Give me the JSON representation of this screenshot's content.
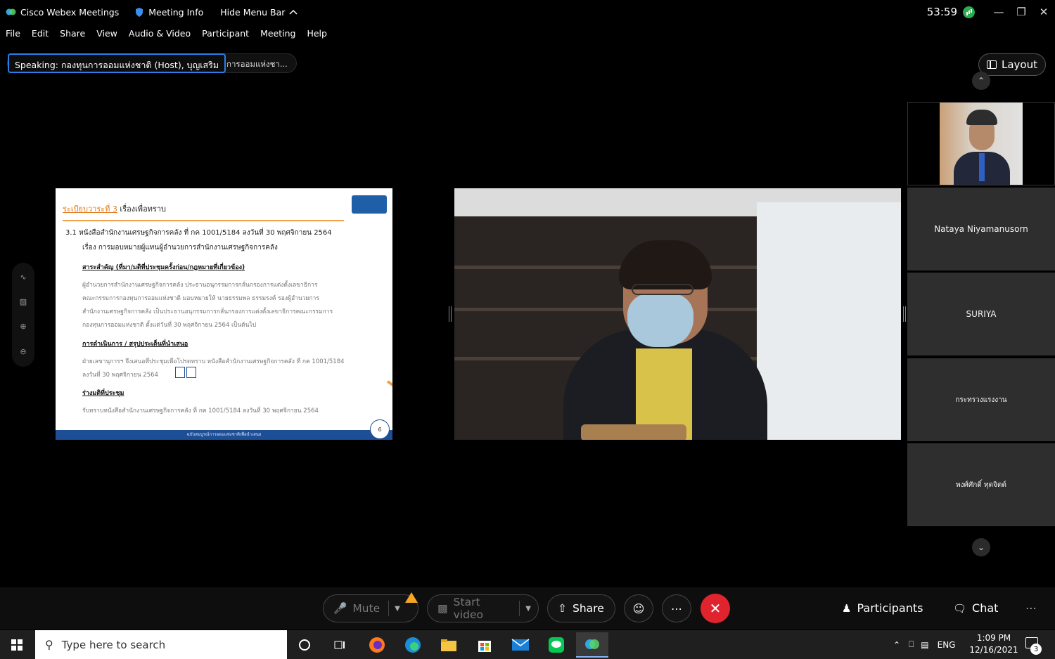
{
  "titlebar": {
    "app_name": "Cisco Webex Meetings",
    "meeting_info": "Meeting Info",
    "hide_menu": "Hide Menu Bar",
    "timer": "53:59"
  },
  "menu": [
    "File",
    "Edit",
    "Share",
    "View",
    "Audio & Video",
    "Participant",
    "Meeting",
    "Help"
  ],
  "speaking": {
    "text": "Speaking: กองทุนการออมแห่งชาติ (Host), บุญเสริม",
    "overflow": "การออมแห่งชา..."
  },
  "layout_label": "Layout",
  "slide": {
    "agenda": "ระเบียบวาระที่ 3",
    "agenda_title": "เรื่องเพื่อทราบ",
    "item_line1": "3.1  หนังสือสำนักงานเศรษฐกิจการคลัง ที่ กค 1001/5184 ลงวันที่ 30 พฤศจิกายน 2564",
    "item_line2": "เรื่อง การมอบหมายผู้แทนผู้อำนวยการสำนักงานเศรษฐกิจการคลัง",
    "section1": "สาระสำคัญ (ที่มา/มติที่ประชุมครั้งก่อน/กฎหมายที่เกี่ยวข้อง)",
    "body1": [
      "ผู้อำนวยการสำนักงานเศรษฐกิจการคลัง ประธานอนุกรรมการกลั่นกรองการแต่งตั้งเลขาธิการ",
      "คณะกรรมการกองทุนการออมแห่งชาติ มอบหมายให้ นายธรรมพล ธรรมรงค์ รองผู้อำนวยการ",
      "สำนักงานเศรษฐกิจการคลัง เป็นประธานอนุกรรมการกลั่นกรองการแต่งตั้งเลขาธิการคณะกรรมการ",
      "กองทุนการออมแห่งชาติ ตั้งแต่วันที่ 30 พฤศจิกายน 2564  เป็นต้นไป"
    ],
    "section2": "การดำเนินการ / สรุปประเด็นที่นำเสนอ",
    "body2": [
      "ฝ่ายเลขานุการฯ จึงเสนอที่ประชุมเพื่อโปรดทราบ หนังสือสำนักงานเศรษฐกิจการคลัง ที่ กค 1001/5184",
      "ลงวันที่ 30 พฤศจิกายน 2564"
    ],
    "section3": "ร่างมติที่ประชุม",
    "body3": "รับทราบหนังสือสำนักงานเศรษฐกิจการคลัง ที่ กค 1001/5184 ลงวันที่ 30 พฤศจิกายน 2564",
    "footer": "ฉบับสมบูรณ์การออมแห่งชาติเพื่อนำเสนอ",
    "page": "6"
  },
  "participants_strip": [
    {
      "name": "",
      "has_video": true
    },
    {
      "name": "Nataya Niyamanusorn",
      "has_video": false
    },
    {
      "name": "SURIYA",
      "has_video": false
    },
    {
      "name": "กระทรวงแรงงาน",
      "has_video": false
    },
    {
      "name": "พงศ์ศักดิ์ ทุดจิตต์",
      "has_video": false
    }
  ],
  "controls": {
    "mute": "Mute",
    "start_video": "Start video",
    "share": "Share",
    "participants": "Participants",
    "chat": "Chat"
  },
  "taskbar": {
    "search_placeholder": "Type here to search",
    "lang": "ENG",
    "time": "1:09 PM",
    "date": "12/16/2021",
    "notifications": "3"
  },
  "colors": {
    "accent_blue": "#2b7de9",
    "end_red": "#e0242e",
    "warning": "#f5a623",
    "signal_green": "#2eaa4f"
  }
}
